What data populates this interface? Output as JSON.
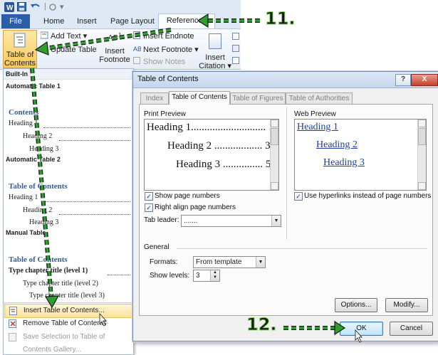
{
  "ribbon": {
    "tabs": [
      "File",
      "Home",
      "Insert",
      "Page Layout",
      "References"
    ],
    "active_tab": "References",
    "toc_button": {
      "line1": "Table of",
      "line2": "Contents"
    },
    "add_text": "Add Text",
    "update_table": "Update Table",
    "insert_footnote": {
      "line1": "Insert",
      "line2": "Footnote"
    },
    "insert_endnote": "Insert Endnote",
    "next_footnote": "Next Footnote",
    "show_notes": "Show Notes",
    "insert_citation": {
      "line1": "Insert",
      "line2": "Citation"
    }
  },
  "gallery": {
    "builtin_label": "Built-In",
    "auto_table_1": {
      "label": "Automatic Table 1",
      "toc_title": "Contents",
      "h1": "Heading 1",
      "h2": "Heading 2",
      "h3": "Heading 3"
    },
    "auto_table_2": {
      "label": "Automatic Table 2",
      "toc_title": "Table of Contents",
      "h1": "Heading 1",
      "h2": "Heading 2",
      "h3": "Heading 3"
    },
    "manual_table": {
      "label": "Manual Table",
      "toc_title": "Table of Contents",
      "l1": "Type chapter title (level 1)",
      "l2": "Type chapter title (level 2)",
      "l3": "Type chapter title (level 3)"
    },
    "menu": [
      {
        "label": "Insert Table of Contents...",
        "highlighted": true
      },
      {
        "label": "Remove Table of Contents",
        "highlighted": false
      },
      {
        "label": "Save Selection to Table of Contents Gallery...",
        "highlighted": false,
        "disabled": true
      }
    ]
  },
  "dialog": {
    "title": "Table of Contents",
    "help": "?",
    "close": "X",
    "tabs": [
      "Index",
      "Table of Contents",
      "Table of Figures",
      "Table of Authorities"
    ],
    "active_tab": "Table of Contents",
    "print_preview": {
      "label": "Print Preview",
      "lines": [
        {
          "text": "Heading 1",
          "dots": "............................",
          "page": "1"
        },
        {
          "text": "Heading 2",
          "dots": "..................",
          "page": "3"
        },
        {
          "text": "Heading 3",
          "dots": "...............",
          "page": "5"
        }
      ]
    },
    "web_preview": {
      "label": "Web Preview",
      "links": [
        "Heading 1",
        "Heading 2",
        "Heading 3"
      ]
    },
    "show_page_numbers": {
      "label": "Show page numbers",
      "checked": true
    },
    "right_align": {
      "label": "Right align page numbers",
      "checked": true
    },
    "tab_leader": {
      "label": "Tab leader:",
      "value": "......."
    },
    "use_hyperlinks": {
      "label": "Use hyperlinks instead of page numbers",
      "checked": true
    },
    "general_label": "General",
    "formats": {
      "label": "Formats:",
      "value": "From template"
    },
    "show_levels": {
      "label": "Show levels:",
      "value": "3"
    },
    "options_button": "Options...",
    "modify_button": "Modify...",
    "ok_button": "OK",
    "cancel_button": "Cancel"
  },
  "annotations": {
    "step_11": "11.",
    "step_12": "12.",
    "arrow_color": "#2e9e2e",
    "number_outline_color": "#7ed957"
  }
}
